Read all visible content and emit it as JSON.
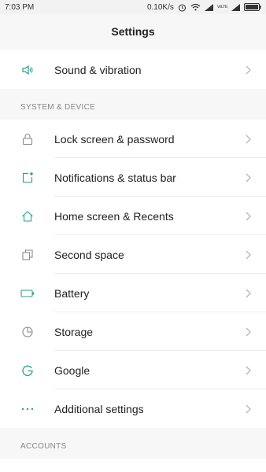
{
  "status_bar": {
    "time": "7:03 PM",
    "network_speed": "0.10K/s",
    "volte_label": "VoLTE"
  },
  "header": {
    "title": "Settings"
  },
  "top_group": {
    "items": [
      {
        "label": "Sound & vibration",
        "icon": "speaker-icon"
      }
    ]
  },
  "system_section": {
    "header": "SYSTEM & DEVICE",
    "items": [
      {
        "label": "Lock screen & password",
        "icon": "lock-icon"
      },
      {
        "label": "Notifications & status bar",
        "icon": "notification-icon"
      },
      {
        "label": "Home screen & Recents",
        "icon": "home-icon"
      },
      {
        "label": "Second space",
        "icon": "second-space-icon"
      },
      {
        "label": "Battery",
        "icon": "battery-icon"
      },
      {
        "label": "Storage",
        "icon": "storage-pie-icon"
      },
      {
        "label": "Google",
        "icon": "google-g-icon"
      },
      {
        "label": "Additional settings",
        "icon": "more-dots-icon"
      }
    ]
  },
  "accounts_section": {
    "header": "ACCOUNTS"
  },
  "colors": {
    "accent": "#2a9d8f",
    "muted_icon": "#8a8a8a"
  }
}
